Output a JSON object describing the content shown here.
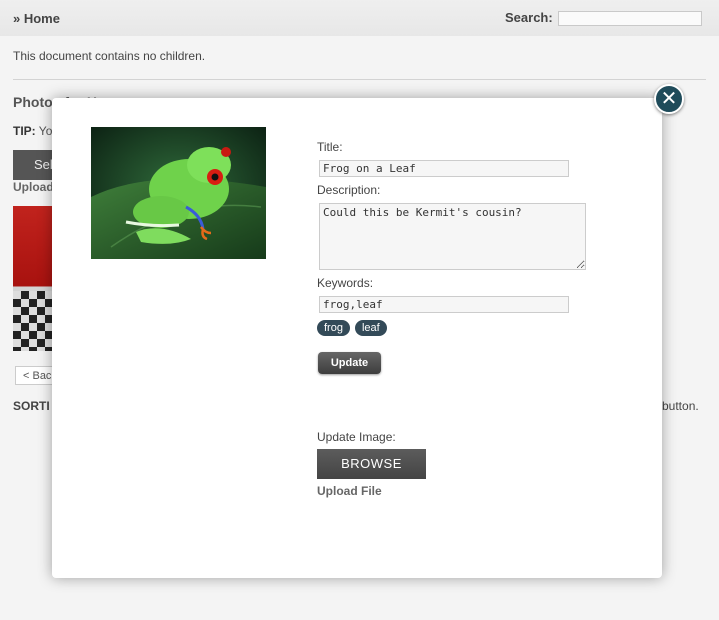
{
  "header": {
    "breadcrumb": "» Home",
    "search_label": "Search:",
    "search_value": ""
  },
  "background": {
    "no_children_text": "This document contains no children.",
    "section_heading": "Photos for Home",
    "tip_bold": "TIP:",
    "tip_text": " Yo",
    "select_button_label": "Sel",
    "upload_link": "Upload",
    "back_button_label": "< Bac",
    "sorting_label": "SORTI",
    "button_tail_text": "button."
  },
  "modal": {
    "close_symbol": "✕",
    "image_alt": "Frog on a Leaf",
    "title_label": "Title:",
    "title_value": "Frog on a Leaf",
    "description_label": "Description:",
    "description_value": "Could this be Kermit's cousin?",
    "keywords_label": "Keywords:",
    "keywords_value": "frog,leaf",
    "keyword_tags": [
      "frog",
      "leaf"
    ],
    "update_button_label": "Update",
    "update_image_label": "Update Image:",
    "browse_button_label": "BROWSE",
    "upload_file_link": "Upload File"
  },
  "colors": {
    "tag_bg": "#334a58",
    "close_button_bg": "#1f4b5a",
    "button_dark": "#444444"
  }
}
